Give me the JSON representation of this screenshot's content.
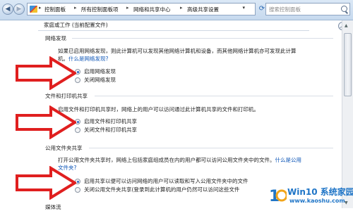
{
  "address_bar": {
    "breadcrumbs": [
      "控制面板",
      "所有控制面板项",
      "网络和共享中心",
      "高级共享设置"
    ],
    "separator": "▸",
    "search_placeholder": "搜索控制面板"
  },
  "profile": {
    "title": "家庭或工作 (当前配置文件)",
    "collapse_glyph": "︿"
  },
  "sections": [
    {
      "title": "网络发现",
      "description": "如果已启用网络发现，则此计算机可以发现其他网络计算机和设备，而其他网络计算机亦可发现此计算机。",
      "link": "什么是网络发现?",
      "options": [
        {
          "label": "启用网络发现",
          "selected": true
        },
        {
          "label": "关闭网络发现",
          "selected": false
        }
      ]
    },
    {
      "title": "文件和打印机共享",
      "description": "启用文件和打印机共享时，网络上的用户可以访问通过此计算机共享的文件和打印机。",
      "options": [
        {
          "label": "启用文件和打印机共享",
          "selected": true
        },
        {
          "label": "关闭文件和打印机共享",
          "selected": false
        }
      ]
    },
    {
      "title": "公用文件夹共享",
      "description": "打开公用文件夹共享时，网络上包括家庭组成员在内的用户都可以访问公用文件夹中的文件。什么是公用文件夹?",
      "description_main": "打开公用文件夹共享时，网络上包括家庭组成员在内的用户都可以访问公用文件夹中的文件。",
      "link": "什么是公用文件夹?",
      "options": [
        {
          "label": "启用共享以便可以访问网络的用户可以读取和写入公用文件夹中的文件",
          "selected": true
        },
        {
          "label": "关闭公用文件夹共享(登录到此计算机的用户仍然可以访问这些文件",
          "selected": false
        }
      ]
    },
    {
      "title": "媒体流"
    }
  ],
  "watermark": {
    "brand": "Win10 系统家园",
    "url": "www.kaoshu.com"
  },
  "colors": {
    "arrow_red": "#e01f1f",
    "link_blue": "#0a53b6",
    "toolbar_blue": "#c6d9ee"
  },
  "icons": {
    "back": "◀",
    "forward": "▶",
    "refresh": "⟳",
    "dropdown": "▾"
  }
}
